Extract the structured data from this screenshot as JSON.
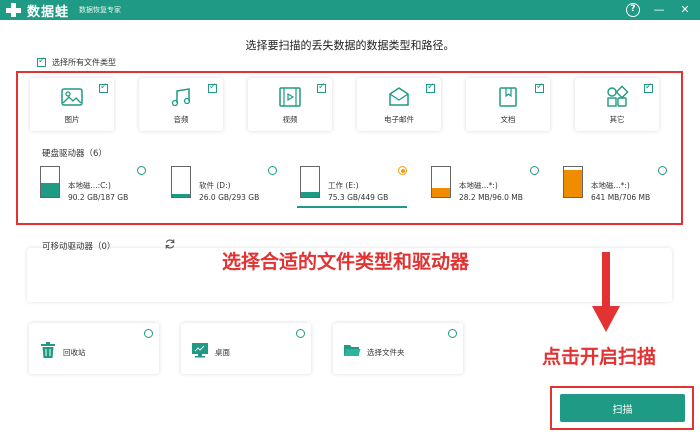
{
  "titlebar": {
    "logo_text": "数据蛙",
    "subtitle": "数据恢复专家",
    "help": "?",
    "minimize": "—",
    "close": "✕"
  },
  "heading": "选择要扫描的丢失数据的数据类型和路径。",
  "select_all": {
    "label": "选择所有文件类型",
    "checked": true
  },
  "file_types": [
    {
      "label": "图片",
      "icon": "image-icon",
      "checked": true
    },
    {
      "label": "音频",
      "icon": "music-icon",
      "checked": true
    },
    {
      "label": "视频",
      "icon": "video-icon",
      "checked": true
    },
    {
      "label": "电子邮件",
      "icon": "mail-icon",
      "checked": true
    },
    {
      "label": "文档",
      "icon": "document-icon",
      "checked": true
    },
    {
      "label": "其它",
      "icon": "other-icon",
      "checked": true
    }
  ],
  "hard_drives": {
    "title": "硬盘驱动器（6）",
    "items": [
      {
        "name": "本地磁...:C:)",
        "size": "90.2 GB/187 GB",
        "used_fraction": 0.48,
        "selected": false,
        "fill_color": "#1f9a84"
      },
      {
        "name": "软件 (D:)",
        "size": "26.0 GB/293 GB",
        "used_fraction": 0.09,
        "selected": false,
        "fill_color": "#1f9a84"
      },
      {
        "name": "工作 (E:)",
        "size": "75.3 GB/449 GB",
        "used_fraction": 0.17,
        "selected": true,
        "fill_color": "#1f9a84"
      },
      {
        "name": "本地磁...*:)",
        "size": "28.2 MB/96.0 MB",
        "used_fraction": 0.29,
        "selected": false,
        "fill_color": "#f08c00"
      },
      {
        "name": "本地磁...*:)",
        "size": "641 MB/706 MB",
        "used_fraction": 0.91,
        "selected": false,
        "fill_color": "#f08c00"
      }
    ]
  },
  "removable": {
    "title": "可移动驱动器（0）"
  },
  "locations": [
    {
      "label": "回收站",
      "icon": "recycle-bin-icon"
    },
    {
      "label": "桌面",
      "icon": "desktop-icon"
    },
    {
      "label": "选择文件夹",
      "icon": "folder-icon"
    }
  ],
  "annotations": {
    "choose_hint": "选择合适的文件类型和驱动器",
    "scan_hint": "点击开启扫描"
  },
  "scan_button": "扫描",
  "colors": {
    "accent": "#1f9a84",
    "annotation": "#e23232",
    "warning": "#f08c00"
  }
}
